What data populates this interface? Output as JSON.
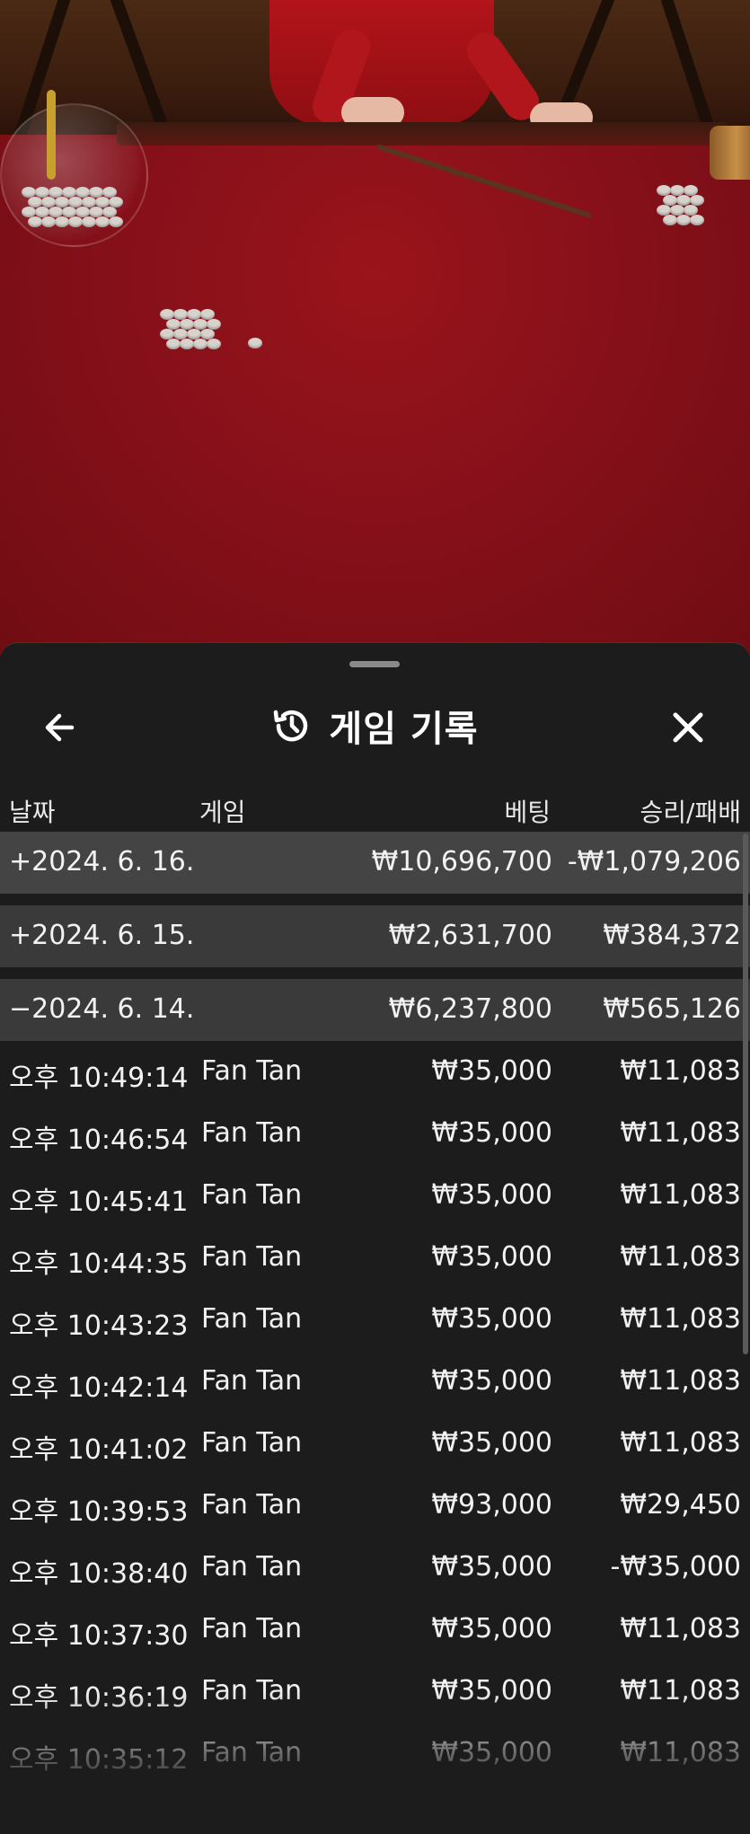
{
  "header": {
    "title": "게임 기록",
    "back_icon": "arrow-left-icon",
    "history_icon": "history-icon",
    "close_icon": "close-icon"
  },
  "columns": {
    "date": "날짜",
    "game": "게임",
    "bet": "베팅",
    "result": "승리/패배"
  },
  "date_groups": [
    {
      "date": "+2024. 6. 16.",
      "bet": "₩10,696,700",
      "result": "-₩1,079,206"
    },
    {
      "date": "+2024. 6. 15.",
      "bet": "₩2,631,700",
      "result": "₩384,372"
    },
    {
      "date": "−2024. 6. 14.",
      "bet": "₩6,237,800",
      "result": "₩565,126"
    }
  ],
  "entries": [
    {
      "time": "오후 10:49:14",
      "game": "Fan Tan",
      "bet": "₩35,000",
      "result": "₩11,083"
    },
    {
      "time": "오후 10:46:54",
      "game": "Fan Tan",
      "bet": "₩35,000",
      "result": "₩11,083"
    },
    {
      "time": "오후 10:45:41",
      "game": "Fan Tan",
      "bet": "₩35,000",
      "result": "₩11,083"
    },
    {
      "time": "오후 10:44:35",
      "game": "Fan Tan",
      "bet": "₩35,000",
      "result": "₩11,083"
    },
    {
      "time": "오후 10:43:23",
      "game": "Fan Tan",
      "bet": "₩35,000",
      "result": "₩11,083"
    },
    {
      "time": "오후 10:42:14",
      "game": "Fan Tan",
      "bet": "₩35,000",
      "result": "₩11,083"
    },
    {
      "time": "오후 10:41:02",
      "game": "Fan Tan",
      "bet": "₩35,000",
      "result": "₩11,083"
    },
    {
      "time": "오후 10:39:53",
      "game": "Fan Tan",
      "bet": "₩93,000",
      "result": "₩29,450"
    },
    {
      "time": "오후 10:38:40",
      "game": "Fan Tan",
      "bet": "₩35,000",
      "result": "-₩35,000"
    },
    {
      "time": "오후 10:37:30",
      "game": "Fan Tan",
      "bet": "₩35,000",
      "result": "₩11,083"
    },
    {
      "time": "오후 10:36:19",
      "game": "Fan Tan",
      "bet": "₩35,000",
      "result": "₩11,083"
    },
    {
      "time": "오후 10:35:12",
      "game": "Fan Tan",
      "bet": "₩35,000",
      "result": "₩11,083"
    }
  ]
}
